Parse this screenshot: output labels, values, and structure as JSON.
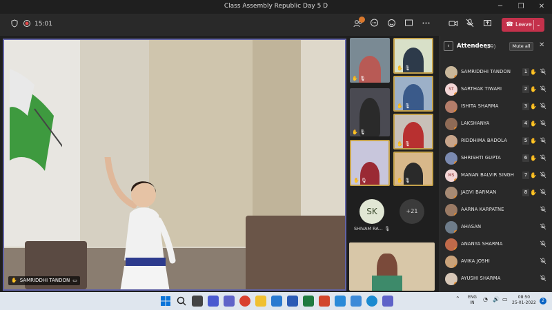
{
  "window": {
    "title": "Class Assembly Republic Day 5 D",
    "minimize": "─",
    "maximize": "❐",
    "close": "✕"
  },
  "toolbar": {
    "timer": "15:01",
    "participants_badge": "",
    "leave_label": "Leave"
  },
  "main_speaker": {
    "name": "SAMRIDDHI TANDON"
  },
  "grid": {
    "sk_initials": "SK",
    "sk_name": "SHIVAM RA...",
    "more_count": "+21"
  },
  "attendees": {
    "title": "Attendees",
    "count": "(29)",
    "mute_all": "Mute all",
    "list": [
      {
        "name": "SAMRIDDHI TANDON",
        "hand": "1",
        "initials": "",
        "color": "#c9b79a"
      },
      {
        "name": "SARTHAK TIWARI",
        "hand": "2",
        "initials": "ST",
        "color": "#f3d6d6"
      },
      {
        "name": "ISHITA SHARMA",
        "hand": "3",
        "initials": "",
        "color": "#b47d6a"
      },
      {
        "name": "LAKSHANYA",
        "hand": "4",
        "initials": "",
        "color": "#8f6b56"
      },
      {
        "name": "RIDDHIMA BADOLA",
        "hand": "5",
        "initials": "",
        "color": "#c7a48a"
      },
      {
        "name": "SHRISHTI GUPTA",
        "hand": "6",
        "initials": "",
        "color": "#7b8ab0"
      },
      {
        "name": "MANAN BALVIR SINGH",
        "hand": "7",
        "initials": "MS",
        "color": "#f3d6d6"
      },
      {
        "name": "JAGVI BARMAN",
        "hand": "8",
        "initials": "",
        "color": "#a68a74"
      },
      {
        "name": "AARNA KARPATNE",
        "hand": "",
        "initials": "",
        "color": "#9a7a64"
      },
      {
        "name": "AHASAN",
        "hand": "",
        "initials": "",
        "color": "#6e7c8a"
      },
      {
        "name": "ANANYA SHARMA",
        "hand": "",
        "initials": "",
        "color": "#c06a4a"
      },
      {
        "name": "AVIKA JOSHI",
        "hand": "",
        "initials": "",
        "color": "#c9a27a"
      },
      {
        "name": "AYUSHI SHARMA",
        "hand": "",
        "initials": "",
        "color": "#d7c7b7"
      }
    ]
  },
  "taskbar": {
    "lang_1": "ENG",
    "lang_2": "IN",
    "time": "08:50",
    "date": "25-01-2022",
    "notif": "2"
  },
  "colors": {
    "accent": "#6264a7",
    "leave": "#c4314b",
    "hand_yellow": "#f4c84a",
    "panel_bg": "#292929"
  }
}
